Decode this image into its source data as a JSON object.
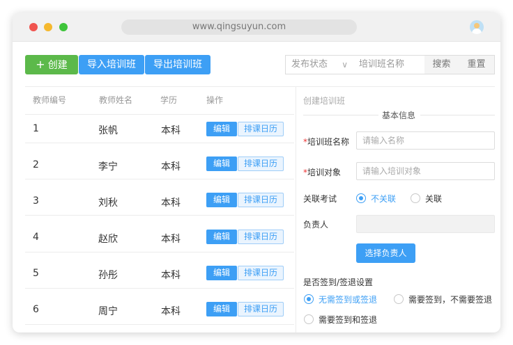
{
  "browser": {
    "url": "www.qingsuyun.com"
  },
  "toolbar": {
    "create_label": "创建",
    "import_label": "导入培训班",
    "export_label": "导出培训班",
    "status_select": "发布状态",
    "name_placeholder": "培训班名称",
    "search_label": "搜索",
    "reset_label": "重置"
  },
  "table": {
    "headers": [
      "教师编号",
      "教师姓名",
      "学历",
      "操作"
    ],
    "edit_label": "编辑",
    "calendar_label": "排课日历",
    "rows": [
      {
        "id": "1",
        "name": "张帆",
        "edu": "本科"
      },
      {
        "id": "2",
        "name": "李宁",
        "edu": "本科"
      },
      {
        "id": "3",
        "name": "刘秋",
        "edu": "本科"
      },
      {
        "id": "4",
        "name": "赵欣",
        "edu": "本科"
      },
      {
        "id": "5",
        "name": "孙彤",
        "edu": "本科"
      },
      {
        "id": "6",
        "name": "周宁",
        "edu": "本科"
      }
    ]
  },
  "form": {
    "title": "创建培训班",
    "section": "基本信息",
    "required_mark": "*",
    "class_name_label": "培训班名称",
    "class_name_placeholder": "请输入名称",
    "target_label": "培训对象",
    "target_placeholder": "请输入培训对象",
    "exam_label": "关联考试",
    "exam_options": [
      "不关联",
      "关联"
    ],
    "exam_selected": "不关联",
    "owner_label": "负责人",
    "choose_owner_label": "选择负责人",
    "sign_label": "是否签到/签退设置",
    "sign_options": [
      "无需签到或签退",
      "需要签到，不需要签退",
      "需要签到和签退"
    ],
    "sign_selected": "无需签到或签退"
  },
  "colors": {
    "primary": "#3d9ff5",
    "success": "#5cb94a"
  }
}
